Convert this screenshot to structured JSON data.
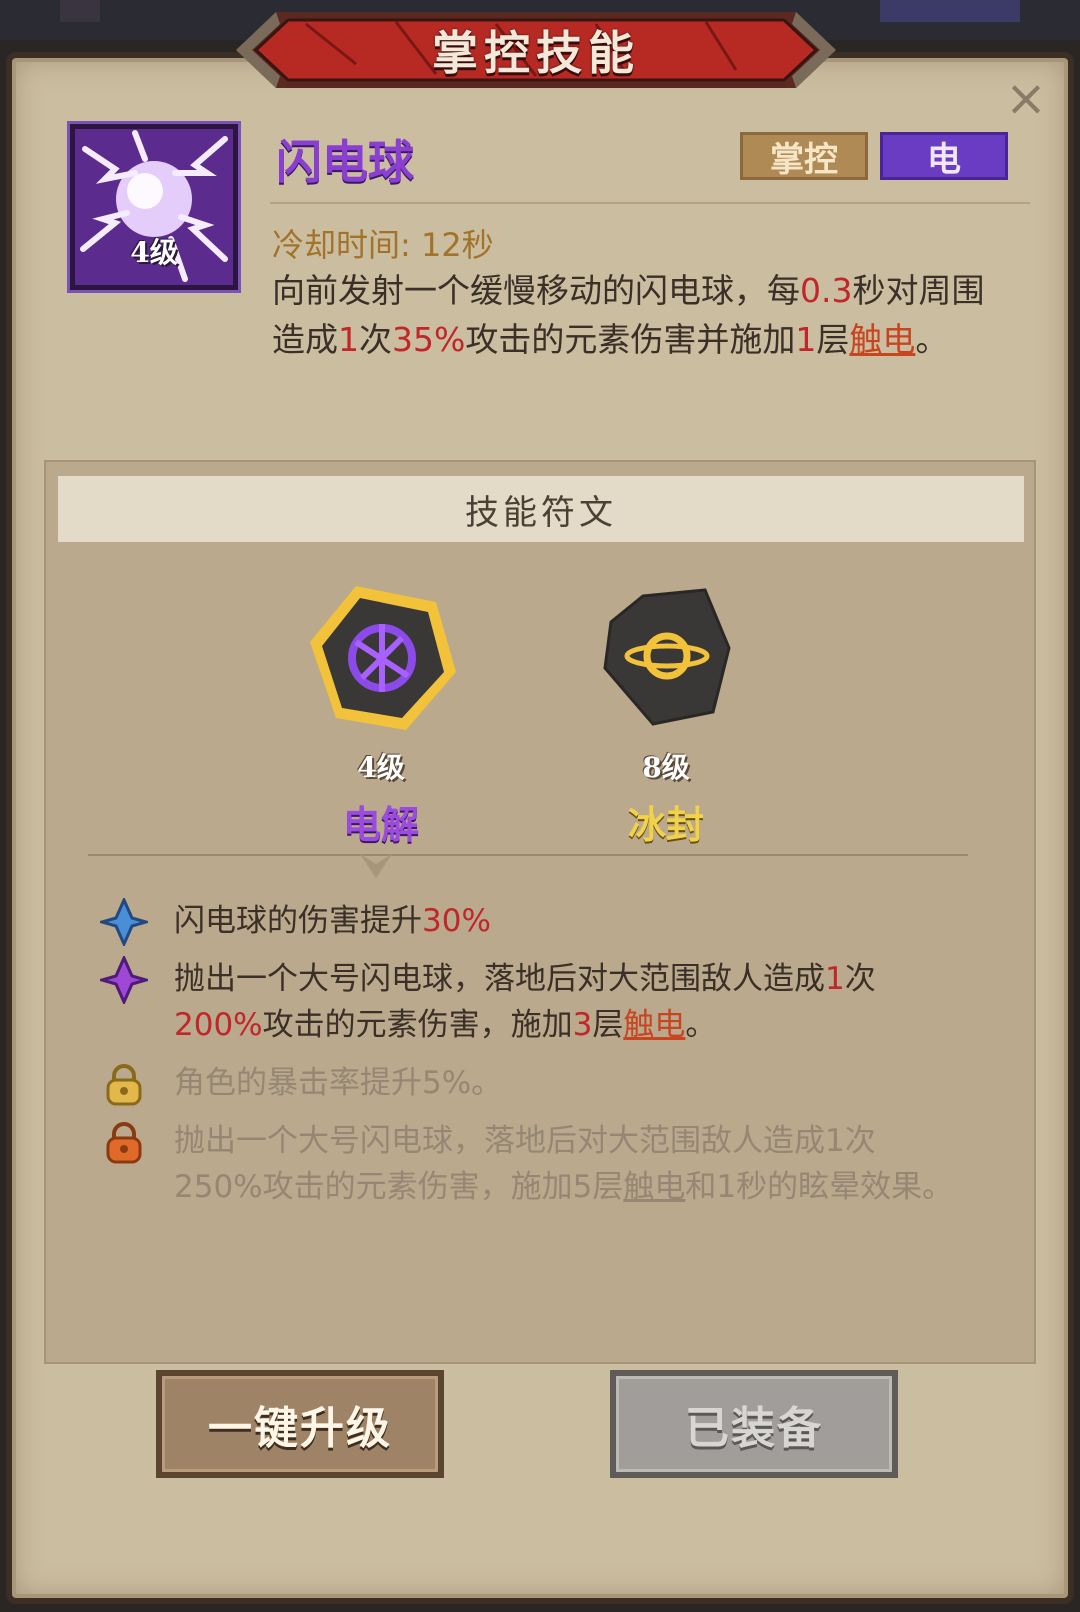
{
  "panel": {
    "title": "掌控技能",
    "close_label": "×"
  },
  "skill": {
    "name": "闪电球",
    "level": "4级",
    "tags": {
      "control": "掌控",
      "element": "电"
    },
    "cooldown": "冷却时间: 12秒",
    "desc": {
      "p1": "向前发射一个缓慢移动的闪电球，每",
      "v1": "0.3",
      "p2": "秒对周围造成",
      "v2": "1",
      "p3": "次",
      "v3": "35%",
      "p4": "攻击的元素伤害并施加",
      "v4": "1",
      "p5": "层",
      "link": "触电",
      "p6": "。"
    }
  },
  "runes": {
    "header": "技能符文",
    "items": [
      {
        "level": "4级",
        "name": "电解"
      },
      {
        "level": "8级",
        "name": "冰封"
      }
    ]
  },
  "effects": [
    {
      "icon": "blue-diamond-icon",
      "a": "闪电球的伤害提升",
      "b": "30%"
    },
    {
      "icon": "purple-diamond-icon",
      "a": "抛出一个大号闪电球，落地后对大范围敌人造成",
      "b": "1",
      "c": "次",
      "d": "200%",
      "e": "攻击的元素伤害，施加",
      "f": "3",
      "g": "层",
      "link": "触电",
      "h": "。"
    },
    {
      "icon": "gold-lock-icon",
      "a": "角色的暴击率提升5%。"
    },
    {
      "icon": "orange-lock-icon",
      "a": "抛出一个大号闪电球，落地后对大范围敌人造成1次250%攻击的元素伤害，施加5层",
      "link": "触电",
      "b": "和1秒的眩晕效果。"
    }
  ],
  "buttons": {
    "upgrade": "一键升级",
    "equipped": "已装备"
  },
  "colors": {
    "panel_bg": "#cbbda0",
    "accent_red": "#c0262a",
    "electric_purple": "#8a3fd0",
    "gold": "#f0d24c"
  }
}
